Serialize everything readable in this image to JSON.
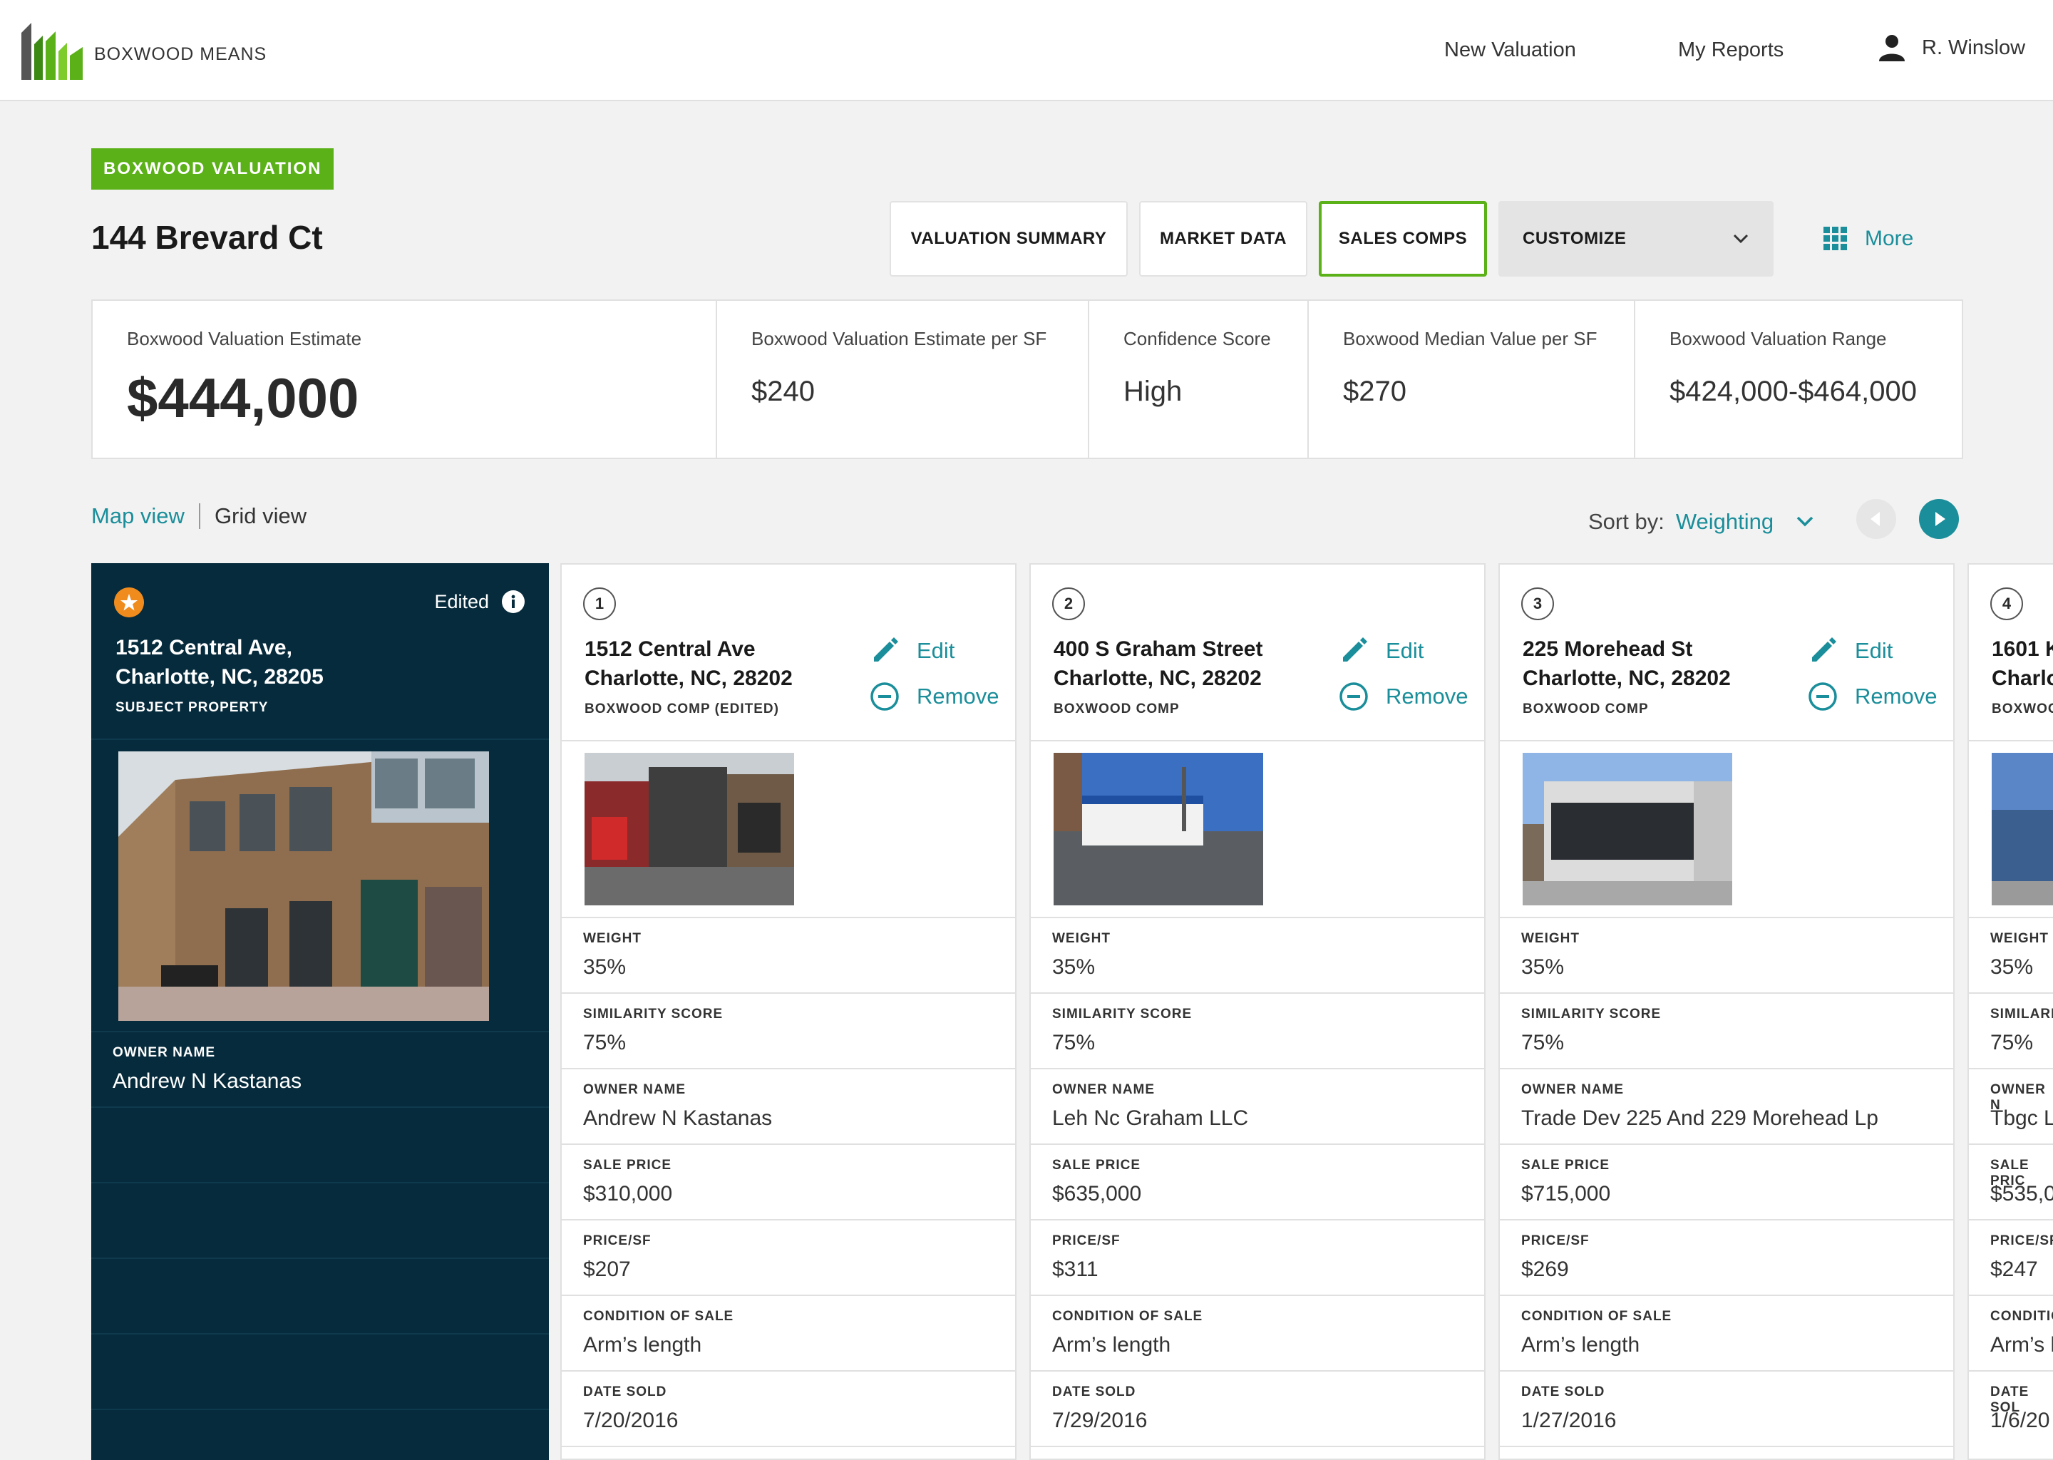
{
  "header": {
    "brand": "BOXWOOD MEANS",
    "nav": {
      "new_valuation": "New Valuation",
      "my_reports": "My Reports"
    },
    "user": "R. Winslow"
  },
  "badge": "BOXWOOD VALUATION",
  "title": "144 Brevard Ct",
  "tabs": {
    "summary": "VALUATION SUMMARY",
    "market": "MARKET DATA",
    "sales": "SALES COMPS",
    "customize": "CUSTOMIZE",
    "more": "More"
  },
  "summary": [
    {
      "label": "Boxwood Valuation Estimate",
      "value": "$444,000"
    },
    {
      "label": "Boxwood Valuation Estimate per SF",
      "value": "$240"
    },
    {
      "label": "Confidence Score",
      "value": "High"
    },
    {
      "label": "Boxwood Median Value per SF",
      "value": "$270"
    },
    {
      "label": "Boxwood Valuation Range",
      "value": "$424,000-$464,000"
    }
  ],
  "views": {
    "map": "Map view",
    "grid": "Grid view"
  },
  "sort": {
    "label": "Sort by:",
    "value": "Weighting"
  },
  "subject": {
    "edited": "Edited",
    "address1": "1512 Central Ave,",
    "address2": "Charlotte, NC, 28205",
    "label": "SUBJECT PROPERTY",
    "owner_label": "OWNER NAME",
    "owner": "Andrew N Kastanas"
  },
  "row_labels": {
    "weight": "WEIGHT",
    "similarity": "SIMILARITY SCORE",
    "owner": "OWNER NAME",
    "sale_price": "SALE PRICE",
    "price_sf": "PRICE/SF",
    "condition": "CONDITION OF SALE",
    "date_sold": "DATE SOLD"
  },
  "actions": {
    "edit": "Edit",
    "remove": "Remove"
  },
  "comps": [
    {
      "num": "1",
      "address1": "1512 Central Ave",
      "address2": "Charlotte, NC, 28202",
      "label": "BOXWOOD COMP (EDITED)",
      "weight": "35%",
      "similarity": "75%",
      "owner": "Andrew N Kastanas",
      "sale_price": "$310,000",
      "price_sf": "$207",
      "condition": "Arm’s length",
      "date_sold": "7/20/2016"
    },
    {
      "num": "2",
      "address1": "400 S Graham Street",
      "address2": "Charlotte, NC, 28202",
      "label": "BOXWOOD COMP",
      "weight": "35%",
      "similarity": "75%",
      "owner": "Leh Nc Graham LLC",
      "sale_price": "$635,000",
      "price_sf": "$311",
      "condition": "Arm’s length",
      "date_sold": "7/29/2016"
    },
    {
      "num": "3",
      "address1": "225 Morehead St",
      "address2": "Charlotte, NC, 28202",
      "label": "BOXWOOD COMP",
      "weight": "35%",
      "similarity": "75%",
      "owner": "Trade Dev 225 And 229 Morehead Lp",
      "sale_price": "$715,000",
      "price_sf": "$269",
      "condition": "Arm’s length",
      "date_sold": "1/27/2016"
    },
    {
      "num": "4",
      "address1": "1601 K",
      "address2": "Charlo",
      "label": "BOXWOO",
      "weight": "35%",
      "similarity": "75%",
      "owner": "Tbgc L",
      "sale_price": "$535,0",
      "price_sf": "$247",
      "condition": "Arm’s l",
      "date_sold": "1/6/20"
    }
  ],
  "comp4_labels": {
    "similarity": "SIMILARIT",
    "owner": "OWNER N",
    "sale_price": "SALE PRIC",
    "condition": "CONDITIO",
    "date_sold": "DATE SOL"
  },
  "colors": {
    "accent_green": "#5bb118",
    "teal": "#1a8e9a",
    "navy": "#062b3c"
  }
}
